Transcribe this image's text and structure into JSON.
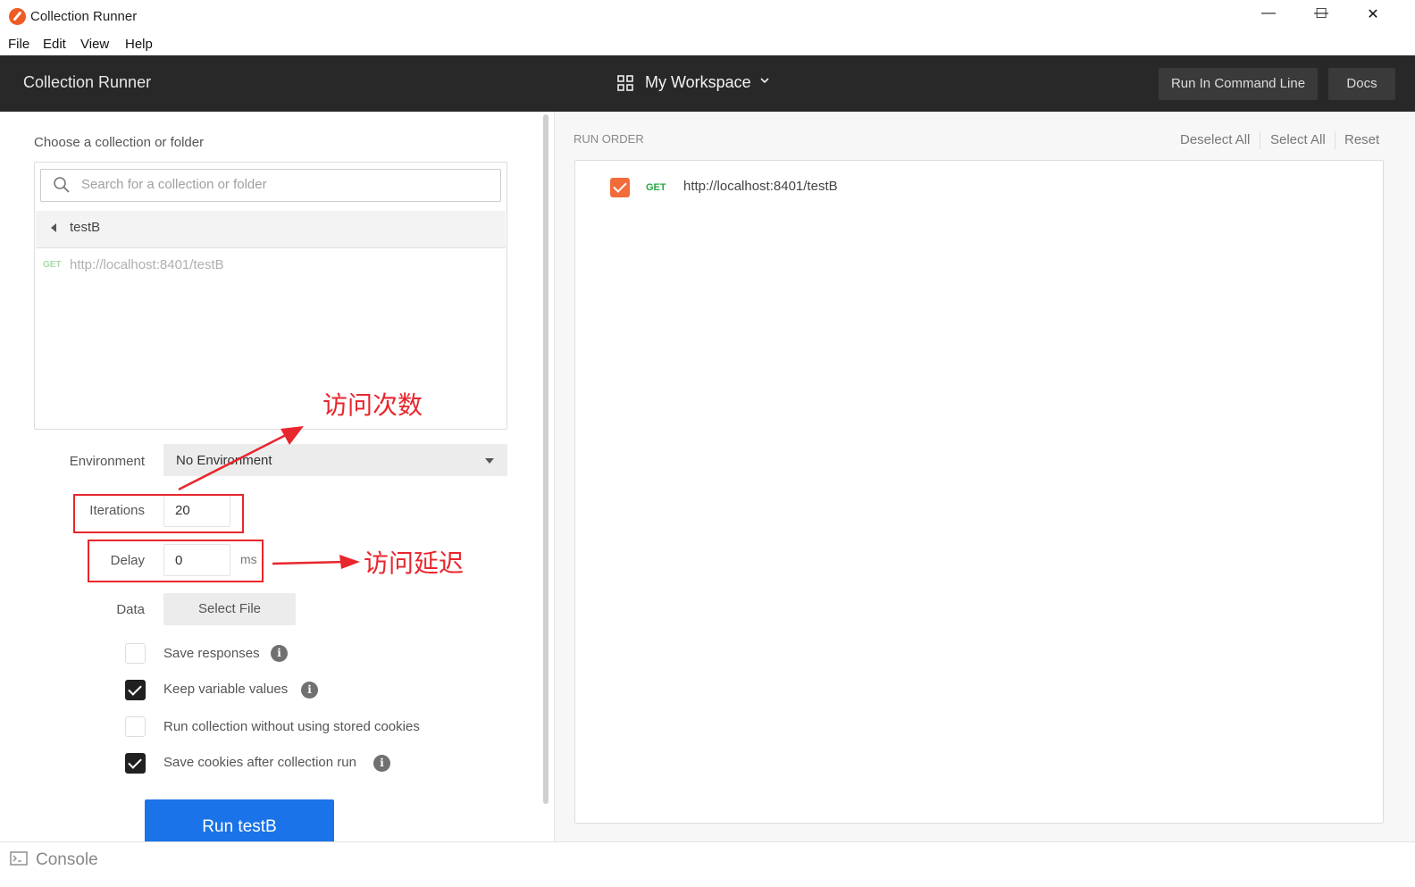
{
  "window": {
    "title": "Collection Runner",
    "controls": {
      "minimize": "—",
      "maximize": "☐",
      "close": "✕"
    }
  },
  "menu": [
    "File",
    "Edit",
    "View",
    "Help"
  ],
  "header": {
    "title": "Collection Runner",
    "workspace": "My Workspace",
    "buttons": {
      "cli": "Run In Command Line",
      "docs": "Docs"
    }
  },
  "left": {
    "choose_label": "Choose a collection or folder",
    "search_placeholder": "Search for a collection or folder",
    "folder": "testB",
    "request": {
      "method": "GET",
      "url": "http://localhost:8401/testB"
    },
    "environment": {
      "label": "Environment",
      "value": "No Environment"
    },
    "iterations": {
      "label": "Iterations",
      "value": "20"
    },
    "delay": {
      "label": "Delay",
      "value": "0",
      "unit": "ms"
    },
    "data": {
      "label": "Data",
      "button": "Select File"
    },
    "options": [
      {
        "label": "Save responses",
        "checked": false,
        "info": true
      },
      {
        "label": "Keep variable values",
        "checked": true,
        "info": true
      },
      {
        "label": "Run collection without using stored cookies",
        "checked": false,
        "info": false
      },
      {
        "label": "Save cookies after collection run",
        "checked": true,
        "info": true
      }
    ],
    "run_button": "Run testB"
  },
  "right": {
    "title": "RUN ORDER",
    "links": {
      "deselect_all": "Deselect All",
      "select_all": "Select All",
      "reset": "Reset"
    },
    "items": [
      {
        "method": "GET",
        "url": "http://localhost:8401/testB",
        "checked": true
      }
    ]
  },
  "console": {
    "label": "Console"
  },
  "annotations": {
    "iterations_note": "访问次数",
    "delay_note": "访问延迟"
  },
  "colors": {
    "accent_orange": "#f26b3a",
    "run_blue": "#1a73e8",
    "header_bg": "#282828",
    "annotation_red": "#e8262d",
    "get_green": "#27a844"
  },
  "icons": {
    "app": "postman-icon",
    "workspace": "grid-icon",
    "search": "search-icon",
    "console": "terminal-icon",
    "info": "info-icon"
  }
}
